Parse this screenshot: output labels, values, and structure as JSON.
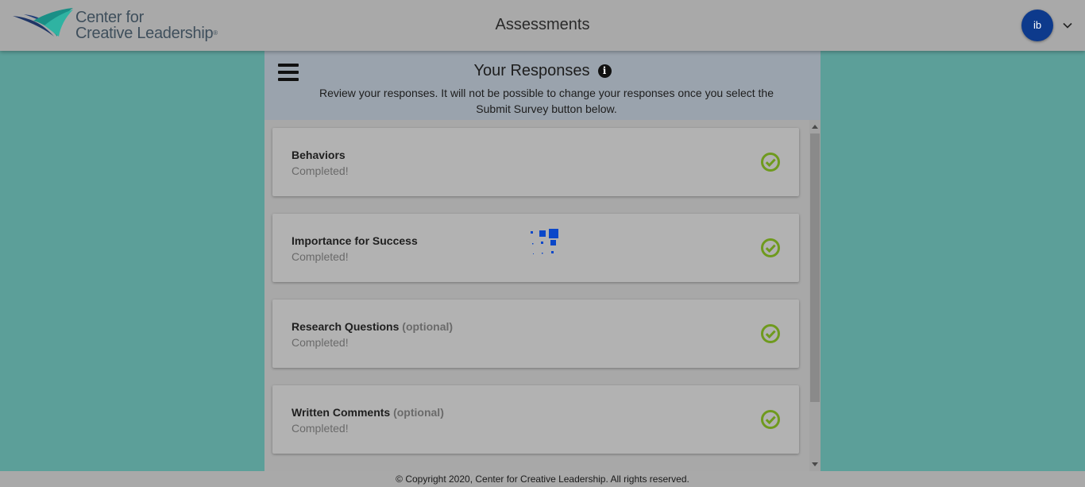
{
  "header": {
    "logo_line1": "Center for",
    "logo_line2": "Creative Leadership",
    "logo_tm": "®",
    "app_title": "Assessments",
    "avatar_initials": "ib",
    "avatar_color": "#0d3a8c",
    "menu_icon": "chevron-down-icon"
  },
  "panel": {
    "menu_icon": "hamburger-icon",
    "title": "Your Responses",
    "info_icon_glyph": "i",
    "subtitle": "Review your responses. It will not be possible to change your responses once you select the Submit Survey button below."
  },
  "sections": [
    {
      "title": "Behaviors",
      "optional": "",
      "status": "Completed!",
      "icon": "check-circle-icon"
    },
    {
      "title": "Importance for Success",
      "optional": "",
      "status": "Completed!",
      "icon": "check-circle-icon"
    },
    {
      "title": "Research Questions",
      "optional": "(optional)",
      "status": "Completed!",
      "icon": "check-circle-icon"
    },
    {
      "title": "Written Comments ",
      "optional": "(optional)",
      "status": "Completed!",
      "icon": "check-circle-icon"
    }
  ],
  "colors": {
    "check": "#6f9a1e",
    "loader": "#0a47c9",
    "teal_background": "#5c9f99"
  },
  "footer": {
    "copyright": "© Copyright 2020, Center for Creative Leadership. All rights reserved."
  }
}
